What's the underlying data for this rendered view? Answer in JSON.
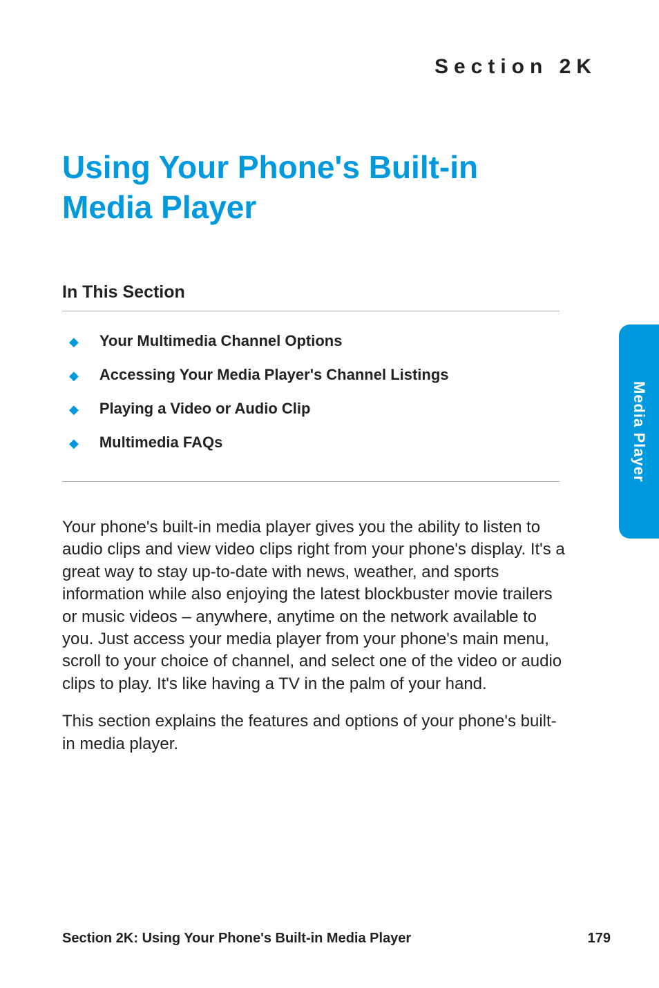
{
  "section_label": "Section 2K",
  "title": "Using Your Phone's Built-in Media Player",
  "subheading": "In This Section",
  "toc": {
    "items": [
      {
        "label": "Your Multimedia Channel Options"
      },
      {
        "label": "Accessing Your Media Player's Channel Listings"
      },
      {
        "label": "Playing a Video or Audio Clip"
      },
      {
        "label": "Multimedia FAQs"
      }
    ]
  },
  "body_paragraphs": [
    "Your phone's built-in media player gives you the ability to listen to audio clips and view video clips right from your phone's display. It's a great way to stay up-to-date with news, weather, and sports information while also enjoying the latest blockbuster movie trailers or music videos – anywhere, anytime on the network available to you. Just access your media player from your phone's main menu, scroll to your choice of channel, and select one of the video or audio clips to play. It's like having a TV in the palm of your hand.",
    "This section explains the features and options of your phone's built-in media player."
  ],
  "footer": {
    "left": "Section 2K: Using Your Phone's Built-in Media Player",
    "right": "179"
  },
  "side_tab": "Media Player",
  "colors": {
    "accent": "#0099dd"
  }
}
